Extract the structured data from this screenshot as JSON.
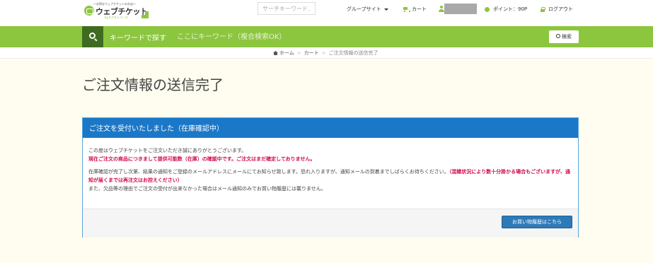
{
  "header": {
    "logo_tagline": "〜お得なウェブチケットのお店〜",
    "logo_name": "ウェブチケット",
    "logo_sub": "byネクストバース",
    "search_placeholder": "サーチキーワード…",
    "group_sites": "グループサイト",
    "cart": "カート",
    "points": "ポイント：90P",
    "logout": "ログアウト"
  },
  "greenbar": {
    "label": "キーワードで探す",
    "placeholder": "ここにキーワード（複合検索OK）",
    "search_button": "検索"
  },
  "breadcrumb": {
    "home": "ホーム",
    "cart": "カート",
    "current": "ご注文情報の送信完了"
  },
  "page": {
    "title": "ご注文情報の送信完了"
  },
  "panel": {
    "heading": "ご注文を受付いたしました（在庫確認中）",
    "line1": "この度はウェブチケットをご注文いただき誠にありがとうございます。",
    "line2_red": "現在ご注文の商品につきまして提供可能数（在庫）の確認中です。ご注文はまだ確定しておりません。",
    "line3": "在庫確認が完了し次第、結果の通知をご登録のメールアドレスにメールにてお知らせ致します。恐れ入りますが、通知メールの到着までしばらくお待ちください。",
    "line3_red": "（混雑状況により数十分掛かる場合もございますが、通知が届くまでは再注文はお控えください）",
    "line4": "また、欠品等の理由でご注文の受付が出来なかった場合はメール通知のみでお買い物履歴には載りません。",
    "history_button": "お買い物履歴はこちら"
  },
  "colors": {
    "brand_green": "#8cc63f",
    "dark_green": "#3f6b21",
    "panel_blue": "#1b78c8",
    "alert_red": "#d10b47"
  }
}
